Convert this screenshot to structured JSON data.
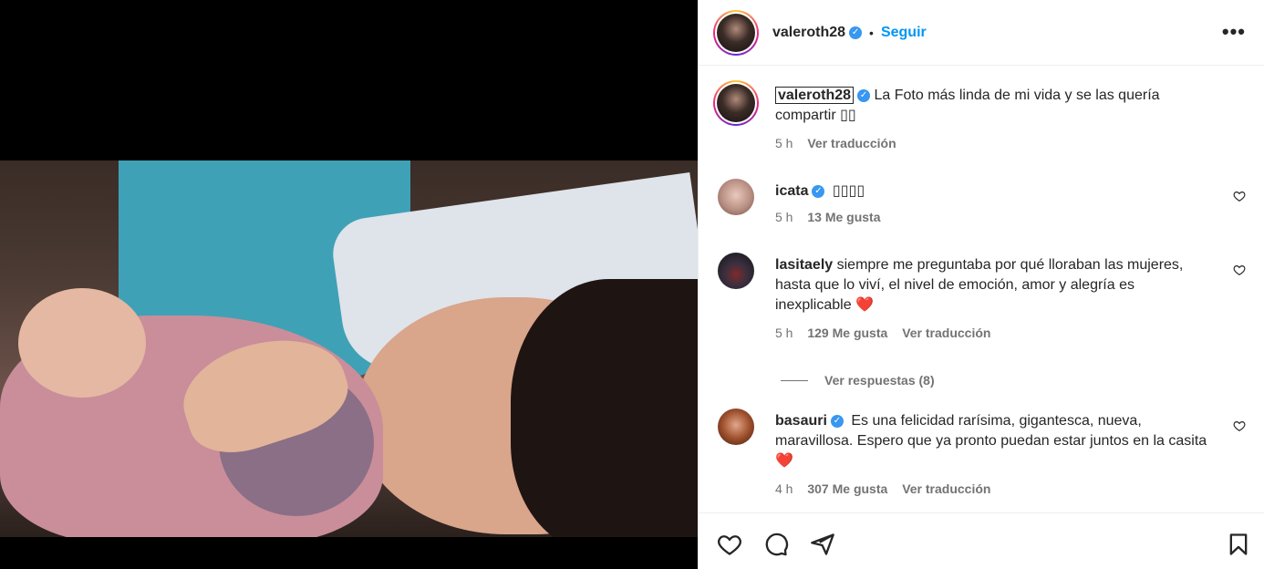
{
  "header": {
    "username": "valeroth28",
    "separator": "•",
    "follow_label": "Seguir",
    "more_label": "•••"
  },
  "caption": {
    "username": "valeroth28",
    "text": "La Foto más linda de mi vida y se las quería compartir ▯▯",
    "time": "5 h",
    "translate": "Ver traducción"
  },
  "comments": [
    {
      "username": "icata",
      "verified": true,
      "text": "▯▯▯▯",
      "time": "5 h",
      "likes": "13 Me gusta",
      "translate": ""
    },
    {
      "username": "lasitaely",
      "verified": false,
      "text": "siempre me preguntaba por qué lloraban las mujeres, hasta que lo viví, el nivel de emoción, amor y alegría es inexplicable",
      "emoji": "❤️",
      "time": "5 h",
      "likes": "129 Me gusta",
      "translate": "Ver traducción",
      "replies": "Ver respuestas (8)"
    },
    {
      "username": "basauri",
      "verified": true,
      "text": "Es una felicidad rarísima, gigantesca, nueva, maravillosa. Espero que ya pronto puedan estar juntos en la casita",
      "emoji": "❤️",
      "time": "4 h",
      "likes": "307 Me gusta",
      "translate": "Ver traducción"
    }
  ],
  "icons": {
    "like": "heart-icon",
    "comment": "comment-icon",
    "share": "share-icon",
    "save": "bookmark-icon"
  },
  "colors": {
    "accent": "#0095f6",
    "verified": "#3897f0",
    "heart": "#ed4956",
    "muted": "#737373"
  }
}
